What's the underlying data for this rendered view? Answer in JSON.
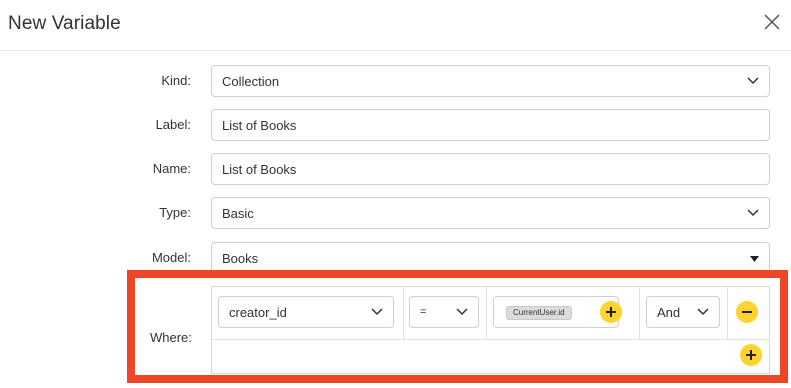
{
  "dialog": {
    "title": "New Variable",
    "close_icon": "close-icon"
  },
  "form": {
    "kind": {
      "label": "Kind:",
      "value": "Collection"
    },
    "label": {
      "label": "Label:",
      "value": "List of Books"
    },
    "name": {
      "label": "Name:",
      "value": "List of Books"
    },
    "type": {
      "label": "Type:",
      "value": "Basic"
    },
    "model": {
      "label": "Model:",
      "value": "Books"
    }
  },
  "where": {
    "label": "Where:",
    "condition": {
      "field": "creator_id",
      "operator": "=",
      "value_chip": "CurrentUser.id",
      "conjunction": "And"
    }
  },
  "colors": {
    "highlight": "#ee4727",
    "accent_button": "#ffd22e"
  }
}
